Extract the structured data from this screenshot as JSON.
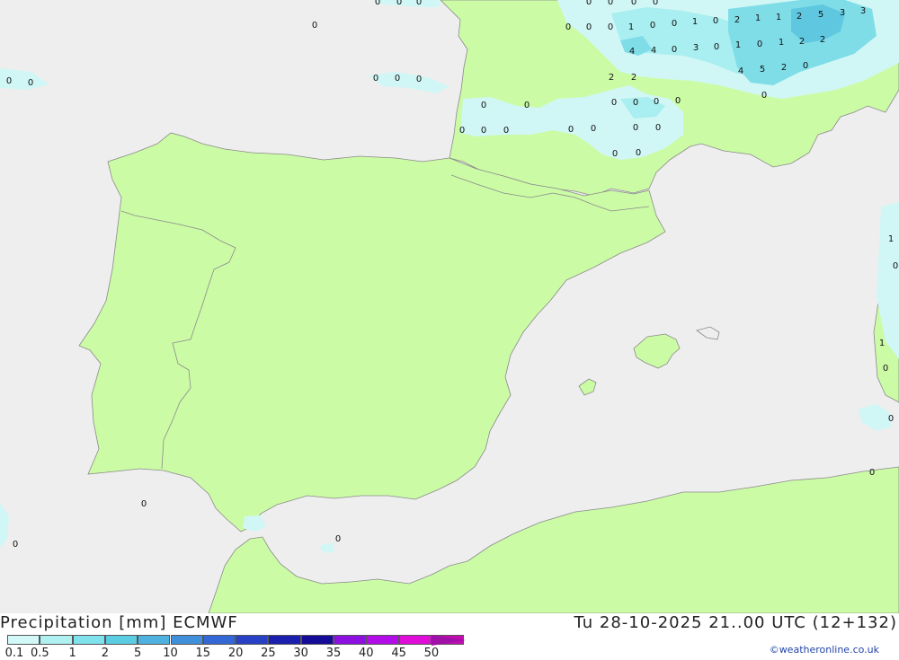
{
  "header": {
    "title": "Precipitation [mm] ECMWF",
    "datetime": "Tu 28-10-2025 21..00 UTC (12+132)",
    "credit": "©weatheronline.co.uk"
  },
  "colors": {
    "sea": "#eeeeee",
    "land": "#ccfba6",
    "border": "#8a8a8a",
    "precip_light": "#d0f7f5",
    "precip_mid": "#a9eef0",
    "precip_heavy": "#7fdde8",
    "precip_core": "#5fc8e0"
  },
  "legend": {
    "labels": [
      "0.1",
      "0.5",
      "1",
      "2",
      "5",
      "10",
      "15",
      "20",
      "25",
      "30",
      "35",
      "40",
      "45",
      "50"
    ],
    "colors": [
      "#d3f8f8",
      "#aff0f1",
      "#7fe2ec",
      "#5bcde3",
      "#4eb1df",
      "#3f8fdb",
      "#3367d6",
      "#2640c6",
      "#1b1fae",
      "#140c96",
      "#8c10e0",
      "#b20ce8",
      "#e00cd8",
      "#c40cb0"
    ],
    "arrow_color": "#a010a8"
  },
  "markers": [
    {
      "v": "0"
    },
    {
      "v": "0"
    },
    {
      "v": "0"
    },
    {
      "v": "0"
    },
    {
      "v": "0"
    },
    {
      "v": "0"
    },
    {
      "v": "0"
    },
    {
      "v": "0"
    },
    {
      "v": "0"
    },
    {
      "v": "0"
    },
    {
      "v": "0"
    },
    {
      "v": "0"
    },
    {
      "v": "0"
    },
    {
      "v": "0"
    },
    {
      "v": "0"
    },
    {
      "v": "0"
    },
    {
      "v": "0"
    },
    {
      "v": "0"
    },
    {
      "v": "0"
    },
    {
      "v": "0"
    },
    {
      "v": "0"
    },
    {
      "v": "0"
    },
    {
      "v": "0"
    },
    {
      "v": "0"
    },
    {
      "v": "0"
    },
    {
      "v": "0"
    },
    {
      "v": "0"
    },
    {
      "v": "0"
    },
    {
      "v": "0"
    },
    {
      "v": "0"
    },
    {
      "v": "1"
    },
    {
      "v": "0"
    },
    {
      "v": "0"
    },
    {
      "v": "1"
    },
    {
      "v": "0"
    },
    {
      "v": "2"
    },
    {
      "v": "1"
    },
    {
      "v": "1"
    },
    {
      "v": "2"
    },
    {
      "v": "5"
    },
    {
      "v": "3"
    },
    {
      "v": "3"
    },
    {
      "v": "4"
    },
    {
      "v": "4"
    },
    {
      "v": "0"
    },
    {
      "v": "3"
    },
    {
      "v": "0"
    },
    {
      "v": "1"
    },
    {
      "v": "0"
    },
    {
      "v": "1"
    },
    {
      "v": "2"
    },
    {
      "v": "2"
    },
    {
      "v": "4"
    },
    {
      "v": "5"
    },
    {
      "v": "2"
    },
    {
      "v": "0"
    },
    {
      "v": "2"
    },
    {
      "v": "2"
    },
    {
      "v": "1"
    },
    {
      "v": "0"
    },
    {
      "v": "1"
    },
    {
      "v": "0"
    },
    {
      "v": "0"
    },
    {
      "v": "0"
    },
    {
      "v": "0"
    },
    {
      "v": "0"
    },
    {
      "v": "0"
    },
    {
      "v": "0"
    },
    {
      "v": "0"
    },
    {
      "v": "0"
    },
    {
      "v": "0"
    },
    {
      "v": "0"
    },
    {
      "v": "0"
    },
    {
      "v": "0"
    },
    {
      "v": "0"
    },
    {
      "v": "0"
    },
    {
      "v": "0"
    },
    {
      "v": "0"
    },
    {
      "v": "0"
    }
  ]
}
